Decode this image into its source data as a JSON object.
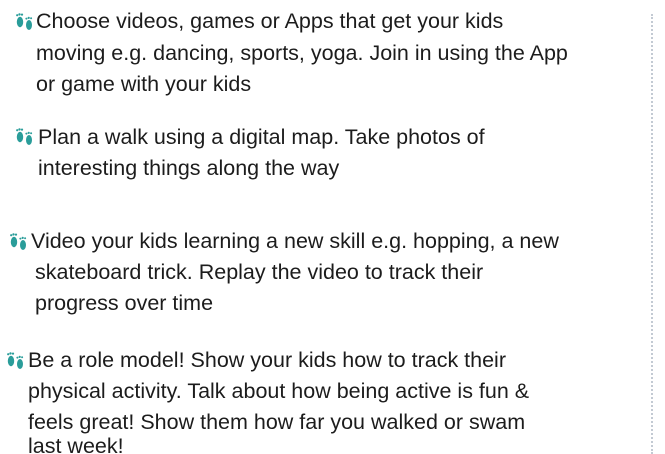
{
  "tips": [
    {
      "icon": "footprints-icon",
      "lines": [
        "Choose videos, games or Apps that get your kids",
        "moving e.g. dancing, sports, yoga. Join in using the App",
        "or game with your kids"
      ]
    },
    {
      "icon": "footprints-icon",
      "lines": [
        "Plan a walk using a digital map. Take photos of",
        "interesting things along the way"
      ]
    },
    {
      "icon": "footprints-icon",
      "lines": [
        "Video your kids learning a new skill e.g. hopping, a new",
        "skateboard trick. Replay the video to track their",
        "progress over time"
      ]
    },
    {
      "icon": "footprints-icon",
      "lines": [
        "Be a role model! Show your kids how to track their",
        "physical activity. Talk about how being active is fun &",
        "feels great! Show them how far you walked or swam",
        "last week!"
      ]
    }
  ],
  "colors": {
    "icon": "#2a9d9a",
    "text": "#1c1c1c",
    "divider": "#c3cad3"
  }
}
